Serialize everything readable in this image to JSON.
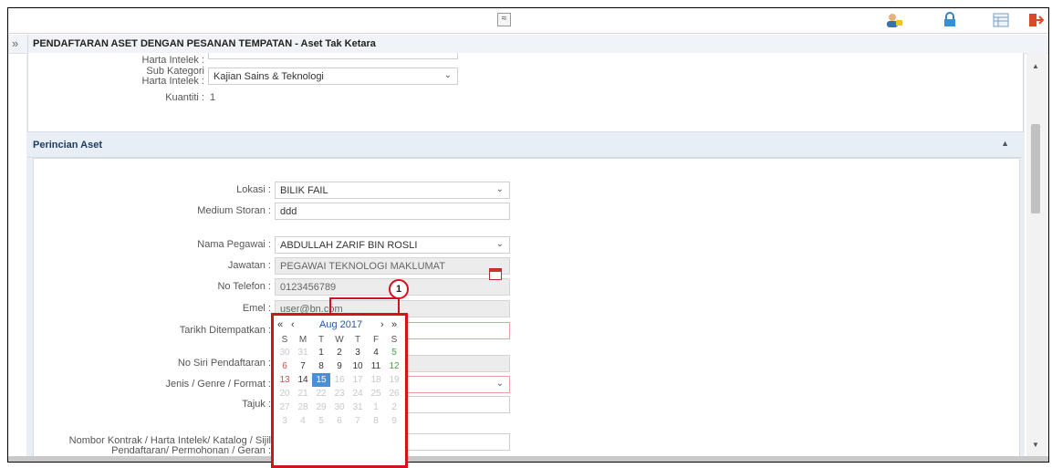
{
  "toolbar": {
    "collapse_glyph": "≈",
    "icons": [
      "user-icon",
      "lock-icon",
      "grid-icon",
      "logout-icon"
    ]
  },
  "page": {
    "expand_glyph": "»",
    "title": "PENDAFTARAN ASET DENGAN PESANAN TEMPATAN - Aset Tak Ketara"
  },
  "top_section": {
    "harta_intelek_label": "Harta Intelek :",
    "sub_kategori_label_1": "Sub Kategori",
    "sub_kategori_label_2": "Harta Intelek :",
    "sub_kategori_value": "Kajian Sains & Teknologi",
    "kuantiti_label": "Kuantiti :",
    "kuantiti_value": "1"
  },
  "perincian": {
    "heading": "Perincian Aset",
    "lokasi_label": "Lokasi :",
    "lokasi_value": "BILIK FAIL",
    "medium_label": "Medium Storan :",
    "medium_value": "ddd",
    "nama_label": "Nama Pegawai :",
    "nama_value": "ABDULLAH ZARIF BIN ROSLI",
    "jawatan_label": "Jawatan :",
    "jawatan_value": "PEGAWAI TEKNOLOGI MAKLUMAT",
    "telefon_label": "No Telefon :",
    "telefon_value": "0123456789",
    "emel_label": "Emel :",
    "emel_value": "user@bn.com",
    "tarikh_label": "Tarikh Ditempatkan :",
    "tarikh_value": "",
    "siri_label": "No Siri Pendaftaran :",
    "jenis_label": "Jenis / Genre / Format :",
    "tajuk_label": "Tajuk :",
    "kontrak_label_1": "Nombor Kontrak / Harta Intelek/ Katalog / Sijil",
    "kontrak_label_2": "Pendaftaran/ Permohonan / Geran :"
  },
  "calendar": {
    "prev_year": "«",
    "prev_month": "‹",
    "month_label": "Aug 2017",
    "next_month": "›",
    "next_year": "»",
    "days_of_week": [
      "S",
      "M",
      "T",
      "W",
      "T",
      "F",
      "S"
    ],
    "weeks": [
      [
        "30",
        "31",
        "1",
        "2",
        "3",
        "4",
        "5"
      ],
      [
        "6",
        "7",
        "8",
        "9",
        "10",
        "11",
        "12"
      ],
      [
        "13",
        "14",
        "15",
        "16",
        "17",
        "18",
        "19"
      ],
      [
        "20",
        "21",
        "22",
        "23",
        "24",
        "25",
        "26"
      ],
      [
        "27",
        "28",
        "29",
        "30",
        "31",
        "1",
        "2"
      ],
      [
        "3",
        "4",
        "5",
        "6",
        "7",
        "8",
        "9"
      ]
    ],
    "selected": "15"
  },
  "callout": {
    "number": "1"
  },
  "colors": {
    "accent_red": "#d0141a",
    "selected_day": "#4a8fd8",
    "section_bg": "#e7eef6"
  }
}
